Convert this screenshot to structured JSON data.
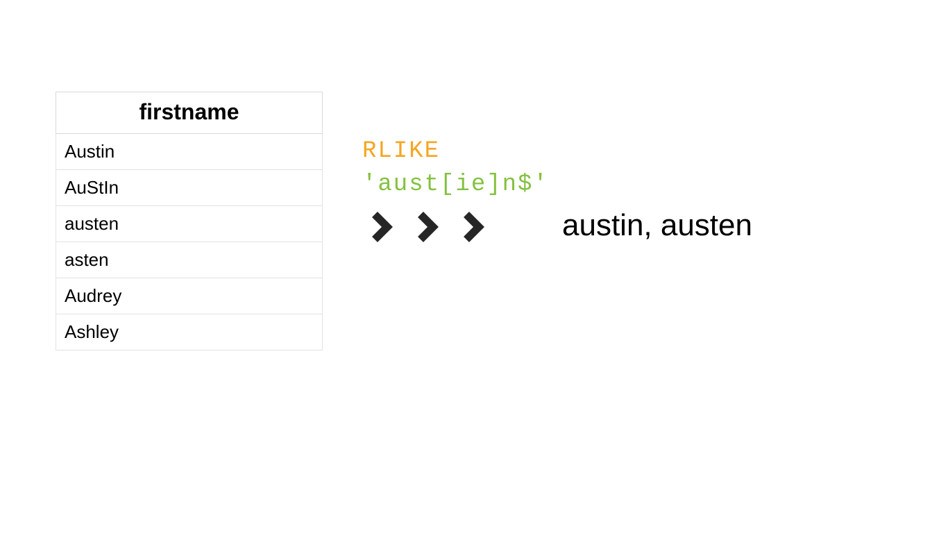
{
  "table": {
    "header": "firstname",
    "rows": [
      "Austin",
      "AuStIn",
      "austen",
      "asten",
      "Audrey",
      "Ashley"
    ]
  },
  "code": {
    "keyword": "RLIKE",
    "pattern": "'aust[ie]n$'"
  },
  "result_text": "austin, austen"
}
